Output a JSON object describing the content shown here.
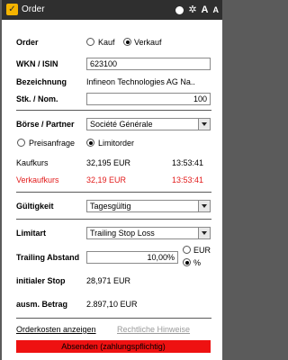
{
  "titlebar": {
    "title": "Order",
    "logo_glyph": "✓",
    "icons": [
      "circle-icon",
      "gear-icon",
      "font-increase-icon",
      "font-decrease-icon"
    ],
    "font_big": "A",
    "font_small": "A"
  },
  "order": {
    "label": "Order",
    "option_buy": "Kauf",
    "option_sell": "Verkauf",
    "selected": "Verkauf"
  },
  "wkn": {
    "label": "WKN / ISIN",
    "value": "623100"
  },
  "bezeichnung": {
    "label": "Bezeichnung",
    "value": "Infineon Technologies AG Na.."
  },
  "stueck": {
    "label": "Stk. / Nom.",
    "value": "100"
  },
  "boerse": {
    "label": "Börse / Partner",
    "value": "Société Générale"
  },
  "query_type": {
    "option_quote": "Preisanfrage",
    "option_limit": "Limitorder",
    "selected": "Limitorder"
  },
  "kaufkurs": {
    "label": "Kaufkurs",
    "value": "32,195 EUR",
    "time": "13:53:41"
  },
  "verkaufkurs": {
    "label": "Verkaufkurs",
    "value": "32,19 EUR",
    "time": "13:53:41",
    "color": "#e21b1b"
  },
  "gueltigkeit": {
    "label": "Gültigkeit",
    "value": "Tagesgültig"
  },
  "limitart": {
    "label": "Limitart",
    "value": "Trailing Stop Loss"
  },
  "trailing": {
    "label": "Trailing Abstand",
    "value": "10,00%",
    "option_eur": "EUR",
    "option_pct": "%",
    "selected": "%"
  },
  "initial_stop": {
    "label": "initialer Stop",
    "value": "28,971 EUR"
  },
  "ausm_betrag": {
    "label": "ausm. Betrag",
    "value": "2.897,10 EUR"
  },
  "links": {
    "costs": "Orderkosten anzeigen",
    "legal": "Rechtliche Hinweise"
  },
  "submit": {
    "label": "Absenden (zahlungspflichtig)",
    "color": "#ee1111"
  }
}
